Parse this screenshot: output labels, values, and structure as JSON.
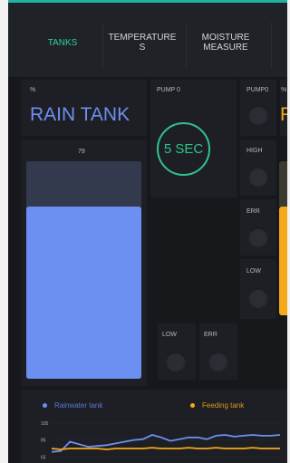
{
  "tabs": [
    {
      "label": "TANKS",
      "active": true
    },
    {
      "label": "TEMPERATURE\nS",
      "active": false
    },
    {
      "label": "MOISTURE\nMEASURE",
      "active": false
    }
  ],
  "rain_tank": {
    "unit": "%",
    "title": "RAIN TANK",
    "value": "79",
    "level_percent": 79
  },
  "pump_timer": {
    "label": "PUMP 0",
    "value": "5 SEC"
  },
  "status_leds": {
    "pump": "PUMP0",
    "high": "HIGH",
    "err": "ERR",
    "low": "LOW"
  },
  "bottom_leds": {
    "low": "LOW",
    "err": "ERR"
  },
  "feeding_tank": {
    "unit_fragment": "%",
    "title_fragment": "F",
    "color": "#f6a91a"
  },
  "chart_data": {
    "type": "line",
    "y_ticks": [
      "105",
      "85",
      "65"
    ],
    "series": [
      {
        "name": "Rainwater tank",
        "color": "#6c8ff2",
        "values": [
          71,
          72,
          83,
          80,
          77,
          78,
          79,
          81,
          83,
          85,
          86,
          91,
          88,
          84,
          86,
          88,
          88,
          86,
          90,
          91,
          89,
          90,
          91,
          90,
          90,
          91
        ]
      },
      {
        "name": "Feeding tank",
        "color": "#f6a91a",
        "values": [
          75,
          74,
          75,
          75,
          75,
          75,
          74,
          75,
          75,
          75,
          75,
          76,
          75,
          75,
          75,
          76,
          75,
          75,
          76,
          75,
          75,
          75,
          76,
          75,
          75,
          75
        ]
      }
    ],
    "ylim": [
      58,
      108
    ]
  },
  "colors": {
    "accent": "#2fd0a2",
    "rain_blue": "#6c8ff2",
    "feeding_amber": "#f6a91a"
  }
}
